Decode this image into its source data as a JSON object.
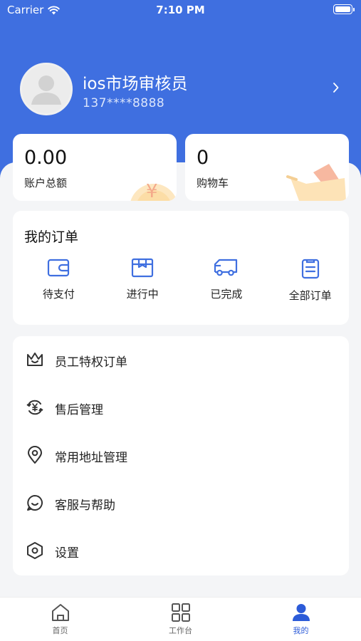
{
  "status_bar": {
    "carrier": "Carrier",
    "time": "7:10 PM"
  },
  "profile": {
    "name": "ios市场审核员",
    "phone": "137****8888"
  },
  "balance_card": {
    "value": "0.00",
    "label": "账户总额"
  },
  "cart_card": {
    "value": "0",
    "label": "购物车"
  },
  "orders": {
    "title": "我的订单",
    "items": [
      {
        "label": "待支付",
        "icon": "wallet-icon"
      },
      {
        "label": "进行中",
        "icon": "package-icon"
      },
      {
        "label": "已完成",
        "icon": "truck-icon"
      },
      {
        "label": "全部订单",
        "icon": "clipboard-icon"
      }
    ]
  },
  "menu": {
    "items": [
      {
        "label": "员工特权订单",
        "icon": "crown-icon"
      },
      {
        "label": "售后管理",
        "icon": "yen-refresh-icon"
      },
      {
        "label": "常用地址管理",
        "icon": "location-pin-icon"
      },
      {
        "label": "客服与帮助",
        "icon": "chat-smile-icon"
      },
      {
        "label": "设置",
        "icon": "hexagon-settings-icon"
      }
    ]
  },
  "tabbar": {
    "items": [
      {
        "label": "首页",
        "icon": "home-icon"
      },
      {
        "label": "工作台",
        "icon": "grid-icon"
      },
      {
        "label": "我的",
        "icon": "person-icon",
        "active": true
      }
    ]
  },
  "colors": {
    "brand": "#3f6fe0",
    "active_tab": "#2c5bd8",
    "background": "#f4f5f7"
  }
}
